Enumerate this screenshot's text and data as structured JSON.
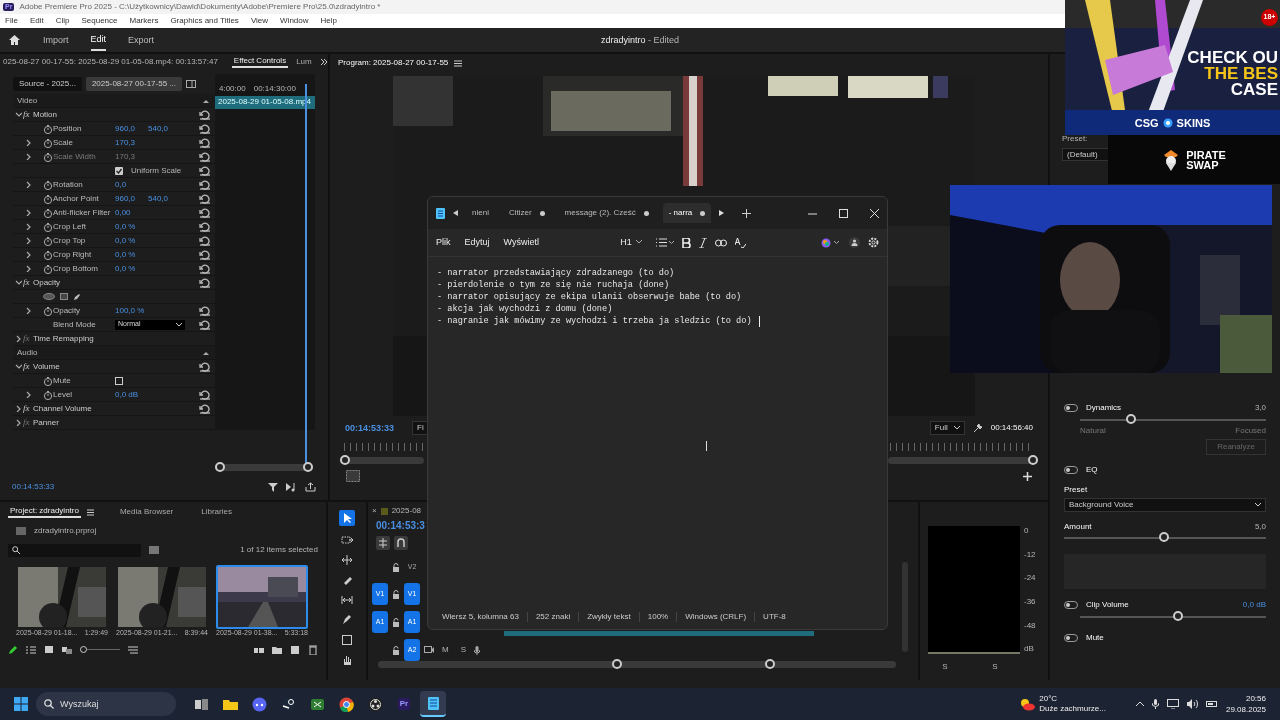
{
  "window": {
    "app_badge": "Pr",
    "title": "Adobe Premiere Pro 2025 - C:\\Użytkownicy\\Dawid\\Dokumenty\\Adobe\\Premiere Pro\\25.0\\zdradyintro *"
  },
  "menu": [
    "File",
    "Edit",
    "Clip",
    "Sequence",
    "Markers",
    "Graphics and Titles",
    "View",
    "Window",
    "Help"
  ],
  "workspaces": [
    {
      "label": "Import",
      "selected": false
    },
    {
      "label": "Edit",
      "selected": true
    },
    {
      "label": "Export",
      "selected": false
    }
  ],
  "project_title": "zdradyintro",
  "project_state": "- Edited",
  "effect_controls": {
    "path": "025-08-27 00-17-55: 2025-08-29 01-05-08.mp4: 00:13:57:47",
    "tabs": [
      {
        "label": "Effect Controls",
        "selected": true
      },
      {
        "label": "Lum",
        "selected": false
      }
    ],
    "source_tabs": [
      {
        "label": "Source - 2025...",
        "selected": false
      },
      {
        "label": "2025-08-27 00-17-55 ...",
        "selected": true
      }
    ],
    "ruler": [
      "4:00:00",
      "00:14:30:00"
    ],
    "clip": "2025-08-29 01-05-08.mp4",
    "rows": [
      {
        "kind": "section",
        "label": "Video"
      },
      {
        "kind": "effect",
        "badge": "fx",
        "label": "Motion",
        "expanded": true,
        "enabled": true,
        "reset": true
      },
      {
        "kind": "property",
        "label": "Position",
        "values": [
          "960,0",
          "540,0"
        ],
        "expandable": false,
        "disabled": false,
        "reset": true
      },
      {
        "kind": "property",
        "label": "Scale",
        "values": [
          "170,3"
        ],
        "expandable": true,
        "disabled": false,
        "reset": true
      },
      {
        "kind": "property",
        "label": "Scale Width",
        "values": [
          "170,3"
        ],
        "expandable": true,
        "disabled": true,
        "reset": true
      },
      {
        "kind": "checkbox",
        "label": "Uniform Scale",
        "checked": true,
        "stopwatch": false,
        "reset": true
      },
      {
        "kind": "property",
        "label": "Rotation",
        "values": [
          "0,0"
        ],
        "expandable": true,
        "disabled": false,
        "reset": true
      },
      {
        "kind": "property",
        "label": "Anchor Point",
        "values": [
          "960,0",
          "540,0"
        ],
        "expandable": false,
        "disabled": false,
        "reset": true
      },
      {
        "kind": "property",
        "label": "Anti-flicker Filter",
        "values": [
          "0,00"
        ],
        "expandable": true,
        "disabled": false,
        "reset": true
      },
      {
        "kind": "property",
        "label": "Crop Left",
        "values": [
          "0,0 %"
        ],
        "expandable": true,
        "disabled": false,
        "reset": true
      },
      {
        "kind": "property",
        "label": "Crop Top",
        "values": [
          "0,0 %"
        ],
        "expandable": true,
        "disabled": false,
        "reset": true
      },
      {
        "kind": "property",
        "label": "Crop Right",
        "values": [
          "0,0 %"
        ],
        "expandable": true,
        "disabled": false,
        "reset": true
      },
      {
        "kind": "property",
        "label": "Crop Bottom",
        "values": [
          "0,0 %"
        ],
        "expandable": true,
        "disabled": false,
        "reset": true
      },
      {
        "kind": "effect",
        "badge": "fx",
        "label": "Opacity",
        "expanded": true,
        "enabled": true,
        "reset": true
      },
      {
        "kind": "masks"
      },
      {
        "kind": "property",
        "label": "Opacity",
        "values": [
          "100,0 %"
        ],
        "expandable": true,
        "disabled": false,
        "reset": true
      },
      {
        "kind": "dropdown",
        "label": "Blend Mode",
        "value": "Normal",
        "reset": true
      },
      {
        "kind": "effect",
        "badge": "fx",
        "label": "Time Remapping",
        "expanded": false,
        "enabled": false,
        "reset": false
      },
      {
        "kind": "section",
        "label": "Audio"
      },
      {
        "kind": "effect",
        "badge": "fx",
        "label": "Volume",
        "expanded": true,
        "enabled": true,
        "reset": true
      },
      {
        "kind": "checkbox",
        "label": "Mute",
        "checked": false,
        "stopwatch": true,
        "reset": false
      },
      {
        "kind": "property",
        "label": "Level",
        "values": [
          "0,0 dB"
        ],
        "expandable": true,
        "disabled": false,
        "reset": true
      },
      {
        "kind": "effect",
        "badge": "fx",
        "label": "Channel Volume",
        "expanded": false,
        "enabled": true,
        "reset": true
      },
      {
        "kind": "effect",
        "badge": "fx",
        "label": "Panner",
        "expanded": false,
        "enabled": false,
        "reset": false
      }
    ],
    "timecode": "00:14:53:33"
  },
  "program": {
    "title": "Program: 2025-08-27 00-17-55",
    "timecode": "00:14:53:33",
    "fit": "Fi",
    "quality": "Full",
    "duration": "00:14:56:40"
  },
  "essential_sound": {
    "preset_label": "Preset:",
    "preset": "(Default)",
    "controls": [
      {
        "kind": "toggle-slider",
        "label": "Dynamics",
        "on": false,
        "reading": "3,0",
        "level": 0.28,
        "left": "Natural",
        "right": "Focused"
      },
      {
        "kind": "button",
        "label": "Reanalyze"
      },
      {
        "kind": "toggle",
        "label": "EQ",
        "on": false
      },
      {
        "kind": "dropdown",
        "label": "Preset",
        "value": "Background Voice"
      },
      {
        "kind": "slider",
        "label": "Amount",
        "reading": "5,0",
        "level": 0.5
      },
      {
        "kind": "graph"
      },
      {
        "kind": "toggle-slider",
        "label": "Clip Volume",
        "on": false,
        "reading": "0,0 dB",
        "level": 0.53
      },
      {
        "kind": "toggle",
        "label": "Mute",
        "on": false
      }
    ]
  },
  "project": {
    "tabs": [
      {
        "label": "Project: zdradyintro",
        "selected": true
      },
      {
        "label": "Media Browser",
        "selected": false
      },
      {
        "label": "Libraries",
        "selected": false
      }
    ],
    "file": "zdradyintro.prproj",
    "zoom": {
      "level": 0
    },
    "selection": "1 of 12 items selected",
    "items": [
      {
        "name": "2025-08-29 01-18...",
        "duration": "1:29:49",
        "selected": false
      },
      {
        "name": "2025-08-29 01-21...",
        "duration": "8:39:44",
        "selected": false
      },
      {
        "name": "2025-08-29 01-38...",
        "duration": "5:33:18",
        "selected": true
      }
    ]
  },
  "timeline": {
    "close": "×",
    "name": "2025-08",
    "timecode": "00:14:53:3",
    "tracks": [
      {
        "target": "V2",
        "targeted": false
      },
      {
        "source": "V1",
        "target": "V1",
        "targeted": true
      },
      {
        "source": "A1",
        "target": "A1",
        "targeted": true
      },
      {
        "target": "A2",
        "targeted": true,
        "buttons": [
          "M",
          "S"
        ]
      }
    ]
  },
  "meters": {
    "scale": [
      "0",
      "-12",
      "-24",
      "-36",
      "-48",
      "dB"
    ],
    "channels": [
      "S",
      "S"
    ]
  },
  "notepad": {
    "tabs": [
      {
        "label": "nieni",
        "modified": false,
        "selected": false
      },
      {
        "label": "Citizer",
        "modified": true,
        "selected": false
      },
      {
        "label": "message (2). Cześć",
        "modified": true,
        "selected": false
      },
      {
        "label": "- narra",
        "modified": true,
        "selected": true
      }
    ],
    "menu": [
      "Plik",
      "Edytuj",
      "Wyświetl"
    ],
    "heading": "H1",
    "lines": [
      "- narrator przedstawiający zdradzanego (to do)",
      "- pierdolenie o tym ze się nie ruchaja (done)",
      "- narrator opisujący ze ekipa ulanii obserwuje babe (to do)",
      "- akcja jak wychodzi z domu (done)",
      "- nagranie jak mówimy ze wychodzi i trzeba ja sledzic (to do)"
    ],
    "status": [
      "Wiersz 5, kolumna 63",
      "252 znaki",
      "Zwykły tekst",
      "100%",
      "Windows (CRLF)",
      "UTF-8"
    ]
  },
  "ad": {
    "headline": [
      "CHECK OU",
      "THE BES",
      "CASE"
    ],
    "brand": [
      "CSG",
      "SKINS"
    ],
    "sponsor": [
      "PIRATE",
      "SWAP"
    ],
    "age": "18+"
  },
  "taskbar": {
    "search": "Wyszukaj",
    "apps": [
      {
        "kind": "taskview",
        "active": false
      },
      {
        "kind": "folder",
        "active": false
      },
      {
        "kind": "chat",
        "active": false
      },
      {
        "kind": "game",
        "active": false
      },
      {
        "kind": "tool",
        "active": false
      },
      {
        "kind": "browser",
        "active": false
      },
      {
        "kind": "record",
        "active": false
      },
      {
        "kind": "editor",
        "label": "Pr",
        "active": false
      },
      {
        "kind": "notepad",
        "active": true
      }
    ],
    "temperature": "20°C",
    "weather": "Duże zachmurze...",
    "time": "20:56",
    "date": "29.08.2025"
  }
}
